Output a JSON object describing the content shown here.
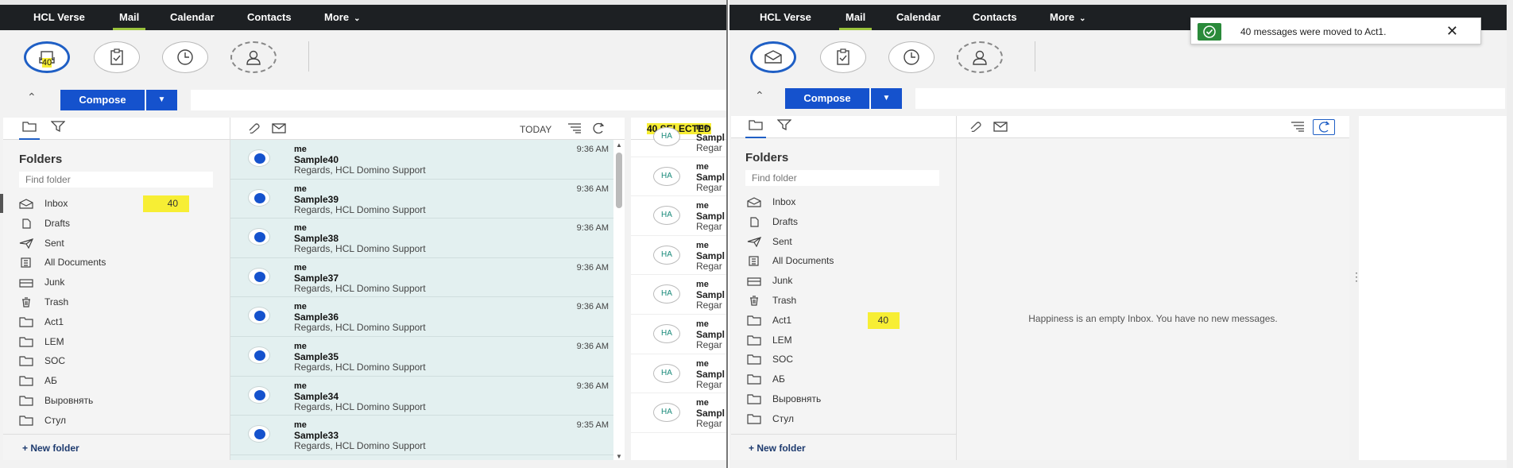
{
  "nav": {
    "brand": "HCL Verse",
    "mail": "Mail",
    "calendar": "Calendar",
    "contacts": "Contacts",
    "more": "More"
  },
  "left": {
    "quick_count": "40",
    "compose_label": "Compose",
    "today_label": "TODAY",
    "selected_label": "40 SELECTED",
    "folders_title": "Folders",
    "find_folder_placeholder": "Find folder",
    "new_folder": "+ New folder",
    "folders": [
      {
        "name": "Inbox",
        "icon": "inbox-icon",
        "count": "40"
      },
      {
        "name": "Drafts",
        "icon": "draft-icon",
        "count": ""
      },
      {
        "name": "Sent",
        "icon": "sent-icon",
        "count": ""
      },
      {
        "name": "All Documents",
        "icon": "all-documents-icon",
        "count": ""
      },
      {
        "name": "Junk",
        "icon": "junk-icon",
        "count": ""
      },
      {
        "name": "Trash",
        "icon": "trash-icon",
        "count": ""
      },
      {
        "name": "Act1",
        "icon": "folder-icon",
        "count": ""
      },
      {
        "name": "LEM",
        "icon": "folder-icon",
        "count": ""
      },
      {
        "name": "SOC",
        "icon": "folder-icon",
        "count": ""
      },
      {
        "name": "АБ",
        "icon": "folder-icon",
        "count": ""
      },
      {
        "name": "Выровнять",
        "icon": "folder-icon",
        "count": ""
      },
      {
        "name": "Стул",
        "icon": "folder-icon",
        "count": ""
      }
    ],
    "messages": [
      {
        "from": "me",
        "subject": "Sample40",
        "snippet": "Regards, HCL Domino Support",
        "time": "9:36 AM"
      },
      {
        "from": "me",
        "subject": "Sample39",
        "snippet": "Regards, HCL Domino Support",
        "time": "9:36 AM"
      },
      {
        "from": "me",
        "subject": "Sample38",
        "snippet": "Regards, HCL Domino Support",
        "time": "9:36 AM"
      },
      {
        "from": "me",
        "subject": "Sample37",
        "snippet": "Regards, HCL Domino Support",
        "time": "9:36 AM"
      },
      {
        "from": "me",
        "subject": "Sample36",
        "snippet": "Regards, HCL Domino Support",
        "time": "9:36 AM"
      },
      {
        "from": "me",
        "subject": "Sample35",
        "snippet": "Regards, HCL Domino Support",
        "time": "9:36 AM"
      },
      {
        "from": "me",
        "subject": "Sample34",
        "snippet": "Regards, HCL Domino Support",
        "time": "9:36 AM"
      },
      {
        "from": "me",
        "subject": "Sample33",
        "snippet": "Regards, HCL Domino Support",
        "time": "9:35 AM"
      }
    ],
    "selected_rows": [
      {
        "avatar": "HA",
        "from": "me",
        "subject": "Sampl",
        "snippet": "Regar"
      },
      {
        "avatar": "HA",
        "from": "me",
        "subject": "Sampl",
        "snippet": "Regar"
      },
      {
        "avatar": "HA",
        "from": "me",
        "subject": "Sampl",
        "snippet": "Regar"
      },
      {
        "avatar": "HA",
        "from": "me",
        "subject": "Sampl",
        "snippet": "Regar"
      },
      {
        "avatar": "HA",
        "from": "me",
        "subject": "Sampl",
        "snippet": "Regar"
      },
      {
        "avatar": "HA",
        "from": "me",
        "subject": "Sampl",
        "snippet": "Regar"
      },
      {
        "avatar": "HA",
        "from": "me",
        "subject": "Sampl",
        "snippet": "Regar"
      },
      {
        "avatar": "HA",
        "from": "me",
        "subject": "Sampl",
        "snippet": "Regar"
      }
    ]
  },
  "right": {
    "compose_label": "Compose",
    "folders_title": "Folders",
    "find_folder_placeholder": "Find folder",
    "new_folder": "+ New folder",
    "empty_message": "Happiness is an empty Inbox. You have no new messages.",
    "toast_text": "40 messages were moved to Act1.",
    "folders": [
      {
        "name": "Inbox",
        "icon": "inbox-icon",
        "count": ""
      },
      {
        "name": "Drafts",
        "icon": "draft-icon",
        "count": ""
      },
      {
        "name": "Sent",
        "icon": "sent-icon",
        "count": ""
      },
      {
        "name": "All Documents",
        "icon": "all-documents-icon",
        "count": ""
      },
      {
        "name": "Junk",
        "icon": "junk-icon",
        "count": ""
      },
      {
        "name": "Trash",
        "icon": "trash-icon",
        "count": ""
      },
      {
        "name": "Act1",
        "icon": "folder-icon",
        "count": "40"
      },
      {
        "name": "LEM",
        "icon": "folder-icon",
        "count": ""
      },
      {
        "name": "SOC",
        "icon": "folder-icon",
        "count": ""
      },
      {
        "name": "АБ",
        "icon": "folder-icon",
        "count": ""
      },
      {
        "name": "Выровнять",
        "icon": "folder-icon",
        "count": ""
      },
      {
        "name": "Стул",
        "icon": "folder-icon",
        "count": ""
      }
    ]
  },
  "colors": {
    "accent": "#1552cd",
    "highlight": "#f7ee34",
    "nav_bg": "#1d2023",
    "nav_active": "#9bc33d",
    "toast_check": "#2a8a3a"
  }
}
